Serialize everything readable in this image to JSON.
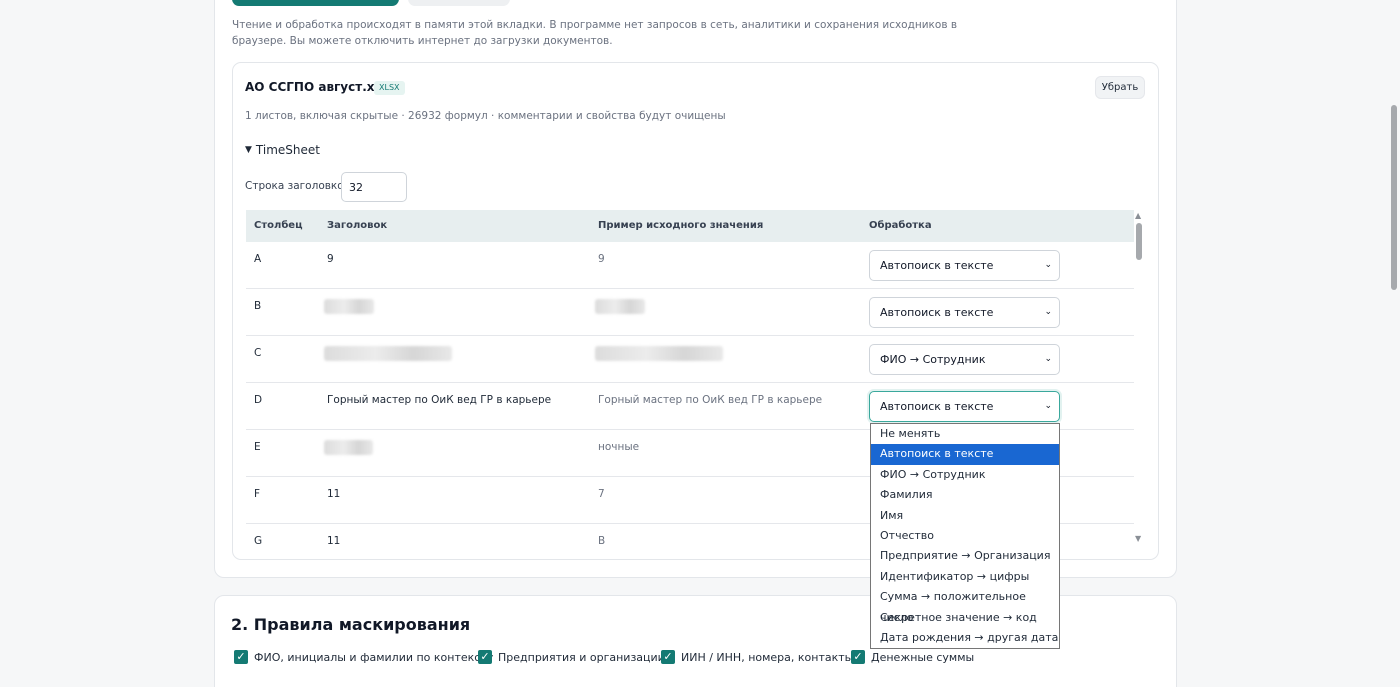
{
  "notice": "Чтение и обработка происходят в памяти этой вкладки. В программе нет запросов в сеть, аналитики и сохранения исходников в браузере. Вы можете отключить интернет до загрузки документов.",
  "file": {
    "name": "АО ССГПО август.xlsx",
    "badge": "XLSX",
    "remove_label": "Убрать",
    "meta": "1 листов, включая скрытые · 26932 формул · комментарии и свойства будут очищены"
  },
  "sheet": {
    "name": "TimeSheet",
    "header_row_label": "Строка заголовков",
    "header_row_value": "32"
  },
  "table": {
    "headers": [
      "Столбец",
      "Заголовок",
      "Пример исходного значения",
      "Обработка"
    ],
    "rows": [
      {
        "col": "A",
        "header": "9",
        "sample": "9",
        "processing": "Автопоиск в тексте"
      },
      {
        "col": "B",
        "header": "",
        "sample": "",
        "processing": "Автопоиск в тексте"
      },
      {
        "col": "C",
        "header": "",
        "sample": "",
        "processing": "ФИО → Сотрудник"
      },
      {
        "col": "D",
        "header": "Горный мастер по ОиК вед ГР в карьере",
        "sample": "Горный мастер по ОиК вед ГР в карьере",
        "processing": "Автопоиск в тексте"
      },
      {
        "col": "E",
        "header": "",
        "sample": "ночные",
        "processing": ""
      },
      {
        "col": "F",
        "header": "11",
        "sample": "7",
        "processing": ""
      },
      {
        "col": "G",
        "header": "11",
        "sample": "В",
        "processing": ""
      }
    ]
  },
  "dropdown": {
    "options": [
      "Не менять",
      "Автопоиск в тексте",
      "ФИО → Сотрудник",
      "Фамилия",
      "Имя",
      "Отчество",
      "Предприятие → Организация",
      "Идентификатор → цифры",
      "Сумма → положительное число",
      "Секретное значение → код",
      "Дата рождения → другая дата"
    ],
    "selected": "Автопоиск в тексте"
  },
  "rules": {
    "title": "2. Правила маскирования",
    "checkboxes": [
      {
        "label": "ФИО, инициалы и фамилии по контексту",
        "checked": true
      },
      {
        "label": "Предприятия и организации",
        "checked": true
      },
      {
        "label": "ИИН / ИНН, номера, контакты",
        "checked": true
      },
      {
        "label": "Денежные суммы",
        "checked": true
      }
    ]
  },
  "colors": {
    "accent": "#147a73",
    "option_highlight": "#1967d2"
  }
}
